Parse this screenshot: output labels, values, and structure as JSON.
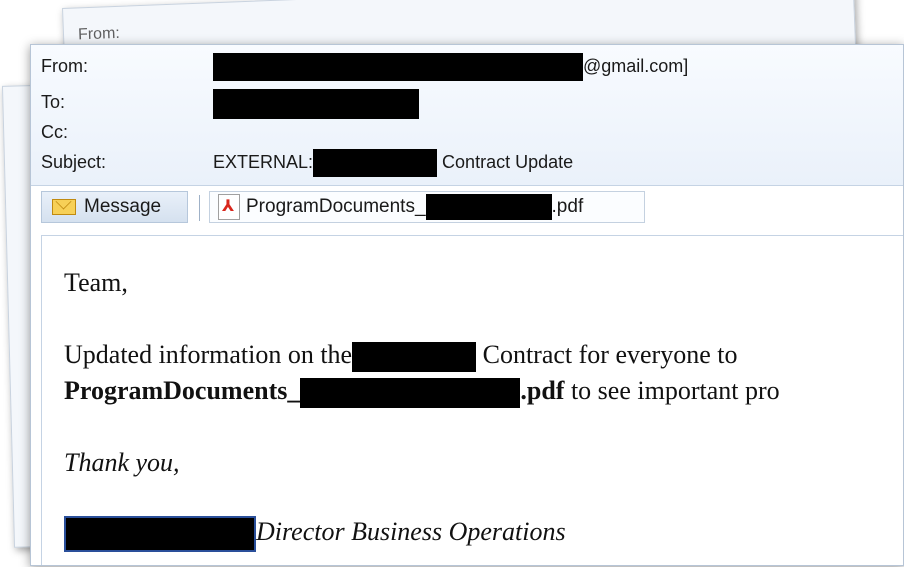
{
  "ghost": {
    "from_label": "From:"
  },
  "header": {
    "from_label": "From:",
    "from_suffix": "@gmail.com]",
    "to_label": "To:",
    "cc_label": "Cc:",
    "subject_label": "Subject:",
    "subject_prefix": "EXTERNAL:",
    "subject_suffix": "Contract Update"
  },
  "attachments": {
    "message_label": "Message",
    "pdf_prefix": "ProgramDocuments_",
    "pdf_suffix": ".pdf"
  },
  "body": {
    "greeting": "Team,",
    "line1_prefix": "Updated information on the",
    "line1_suffix": "Contract for everyone to",
    "line2_bold_prefix": "ProgramDocuments_",
    "line2_bold_suffix": ".pdf",
    "line2_rest": "to see important pro",
    "thanks": "Thank you,",
    "signature_title": "Director Business Operations"
  },
  "colors": {
    "redaction": "#000000",
    "header_bg": "#eaf1fa",
    "border": "#b7c5d6"
  }
}
